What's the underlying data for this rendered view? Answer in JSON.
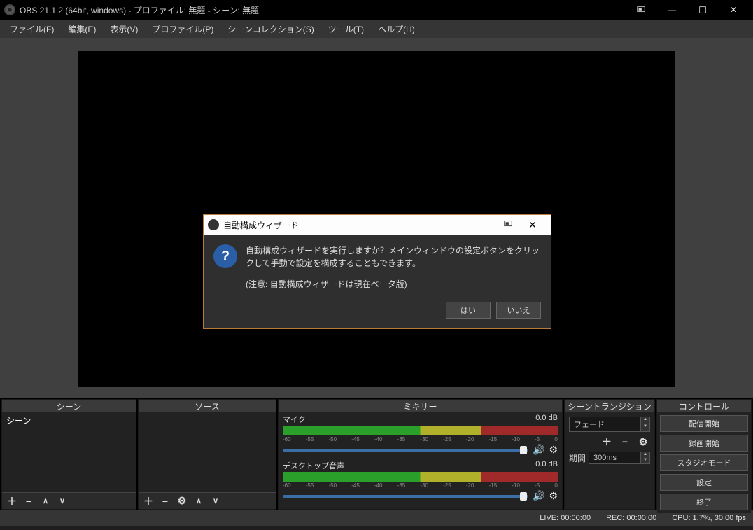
{
  "titlebar": {
    "title": "OBS 21.1.2 (64bit, windows) - プロファイル: 無題 - シーン: 無題"
  },
  "menu": {
    "file": "ファイル(F)",
    "edit": "編集(E)",
    "view": "表示(V)",
    "profile": "プロファイル(P)",
    "scenecol": "シーンコレクション(S)",
    "tools": "ツール(T)",
    "help": "ヘルプ(H)"
  },
  "panels": {
    "scenes_hdr": "シーン",
    "sources_hdr": "ソース",
    "mixer_hdr": "ミキサー",
    "trans_hdr": "シーントランジション",
    "controls_hdr": "コントロール"
  },
  "scenes": {
    "item0": "シーン"
  },
  "mixer": {
    "mic_label": "マイク",
    "mic_db": "0.0 dB",
    "desk_label": "デスクトップ音声",
    "desk_db": "0.0 dB",
    "ticks": [
      "-60",
      "-55",
      "-50",
      "-45",
      "-40",
      "-35",
      "-30",
      "-25",
      "-20",
      "-15",
      "-10",
      "-5",
      "0"
    ]
  },
  "trans": {
    "fade": "フェード",
    "dur_label": "期間",
    "dur_value": "300ms"
  },
  "controls": {
    "start_stream": "配信開始",
    "start_rec": "録画開始",
    "studio": "スタジオモード",
    "settings": "設定",
    "exit": "終了"
  },
  "status": {
    "live": "LIVE: 00:00:00",
    "rec": "REC: 00:00:00",
    "cpu": "CPU: 1.7%, 30.00 fps"
  },
  "dialog": {
    "title": "自動構成ウィザード",
    "msg": "自動構成ウィザードを実行しますか？メインウィンドウの設定ボタンをクリックして手動で設定を構成することもできます。",
    "note": "(注意: 自動構成ウィザードは現在ベータ版)",
    "yes": "はい",
    "no": "いいえ"
  }
}
